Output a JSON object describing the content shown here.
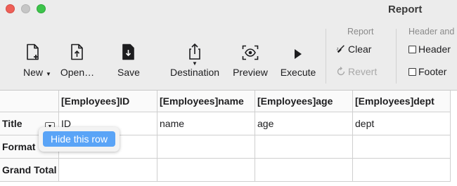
{
  "window": {
    "title": "Report"
  },
  "toolbar": {
    "new_label": "New",
    "open_label": "Open…",
    "save_label": "Save",
    "destination_label": "Destination",
    "preview_label": "Preview",
    "execute_label": "Execute"
  },
  "report_group": {
    "title": "Report",
    "clear_label": "Clear",
    "revert_label": "Revert"
  },
  "header_group": {
    "title": "Header and",
    "header_label": "Header",
    "footer_label": "Footer"
  },
  "grid": {
    "columns": [
      "[Employees]ID",
      "[Employees]name",
      "[Employees]age",
      "[Employees]dept"
    ],
    "rows": [
      {
        "label": "Title",
        "cells": [
          "ID",
          "name",
          "age",
          "dept"
        ]
      },
      {
        "label": "Format",
        "cells": [
          "",
          "",
          "",
          ""
        ]
      },
      {
        "label": "Grand Total",
        "cells": [
          "",
          "",
          "",
          ""
        ]
      }
    ]
  },
  "popup": {
    "hide_row_label": "Hide this row"
  },
  "colors": {
    "accent": "#5aa4f7",
    "close": "#ee5f57",
    "maximize": "#3dc44b"
  }
}
